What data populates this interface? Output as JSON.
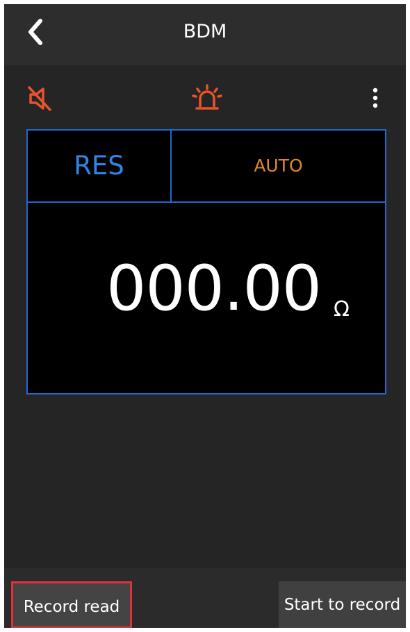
{
  "header": {
    "title": "BDM",
    "back_icon": "chevron-left-icon"
  },
  "toolbar": {
    "mute_icon": "speaker-muted-icon",
    "alarm_icon": "alarm-siren-icon",
    "menu_icon": "more-vertical-icon",
    "icon_color": "#e8542a"
  },
  "meter": {
    "mode": "RES",
    "range": "AUTO",
    "value": "000.00",
    "unit": "Ω",
    "border_color": "#1f6ad0",
    "mode_color": "#2f86e6",
    "range_color": "#d98a2c"
  },
  "footer": {
    "record_read_label": "Record read",
    "start_record_label": "Start to record",
    "highlight_color": "#e0313a"
  }
}
